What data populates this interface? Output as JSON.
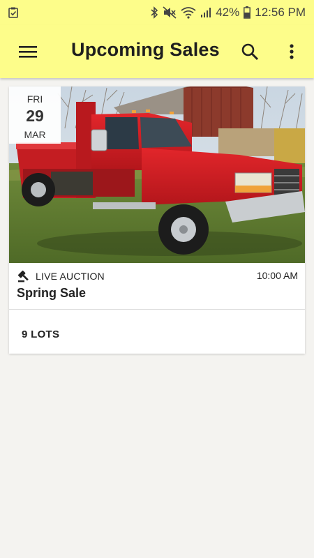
{
  "status_bar": {
    "battery": "42%",
    "time": "12:56 PM",
    "icons": [
      "task-check-icon",
      "bluetooth-icon",
      "mute-icon",
      "wifi-icon",
      "signal-icon",
      "battery-icon"
    ]
  },
  "app_bar": {
    "title": "Upcoming Sales",
    "background": "#fdfd8a",
    "icons": [
      "menu-icon",
      "search-icon",
      "more-vert-icon"
    ]
  },
  "sales": [
    {
      "day_of_week": "FRI",
      "day": "29",
      "month": "MAR",
      "type": "LIVE AUCTION",
      "type_icon": "gavel-icon",
      "time": "10:00 AM",
      "name": "Spring Sale",
      "lots": "9 LOTS",
      "photo": "red pickup truck with dump bed parked on grass near a barn"
    }
  ]
}
